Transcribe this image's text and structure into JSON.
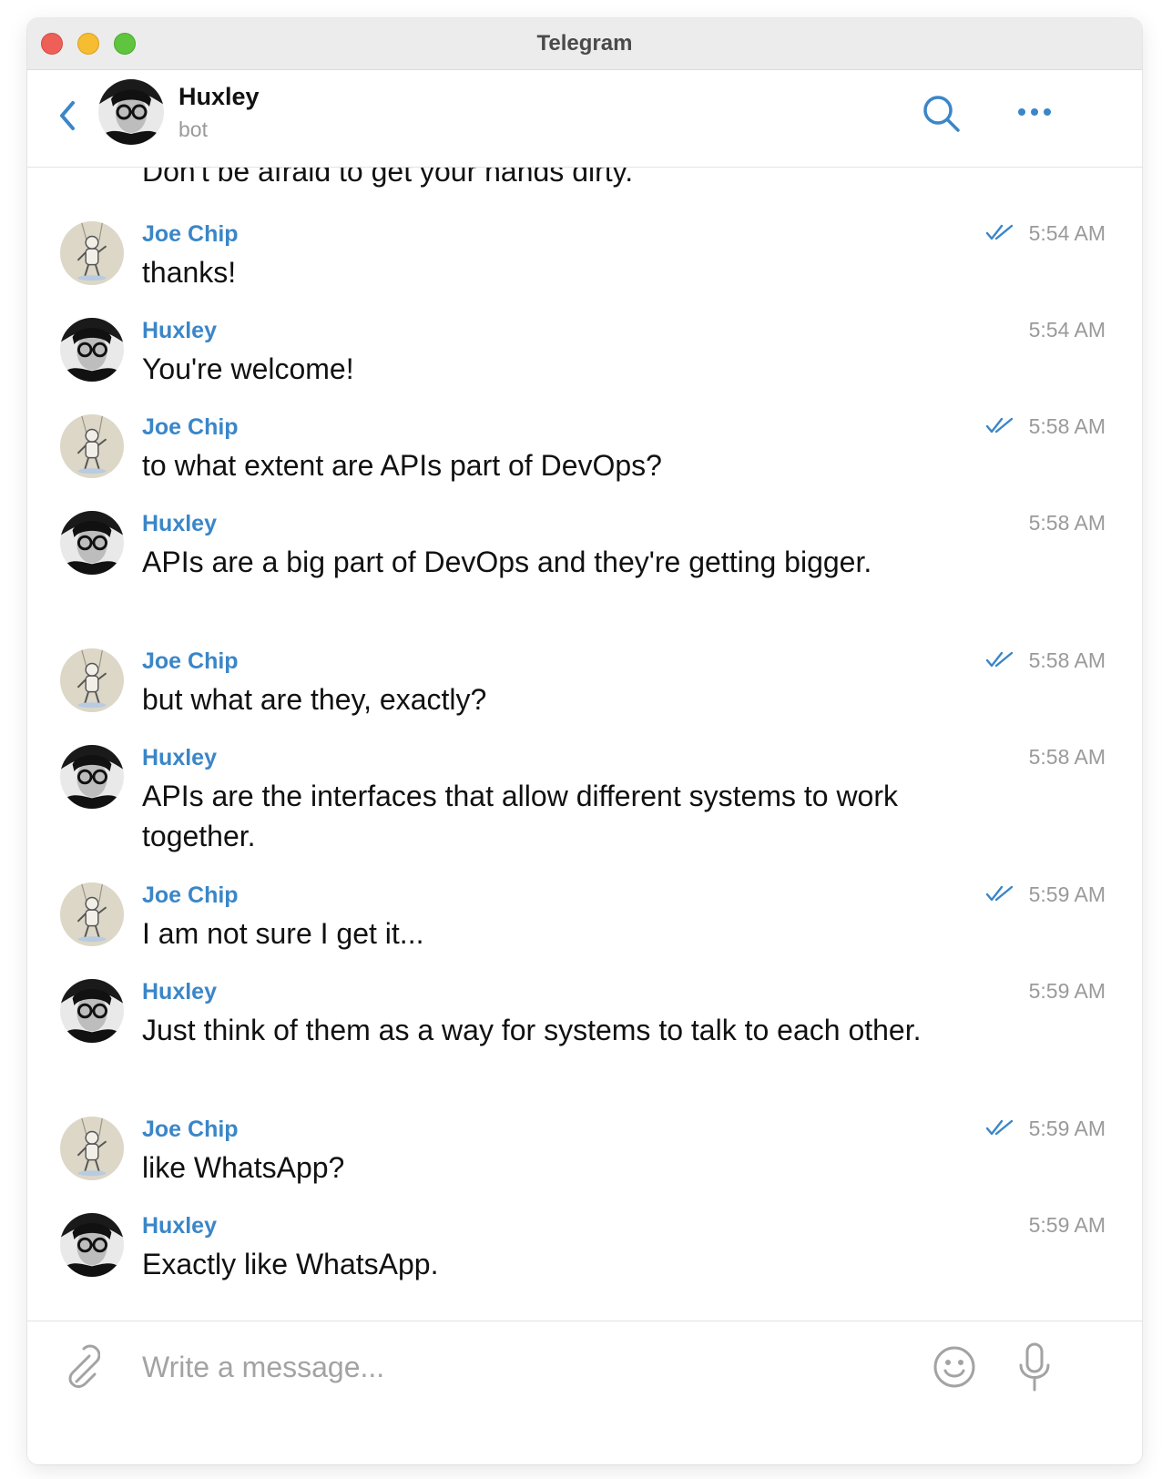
{
  "window": {
    "title": "Telegram"
  },
  "header": {
    "name": "Huxley",
    "status": "bot"
  },
  "chat": {
    "clipped_previous_text": "Don't be afraid to get your hands dirty.",
    "messages": [
      {
        "sender": "Joe Chip",
        "avatar": "joe",
        "text": "thanks!",
        "time": "5:54 AM",
        "read": true
      },
      {
        "sender": "Huxley",
        "avatar": "huxley",
        "text": "You're welcome!",
        "time": "5:54 AM",
        "read": false
      },
      {
        "sender": "Joe Chip",
        "avatar": "joe",
        "text": "to what extent are APIs part of DevOps?",
        "time": "5:58 AM",
        "read": true
      },
      {
        "sender": "Huxley",
        "avatar": "huxley",
        "text": "APIs are a big part of DevOps and they're getting bigger.",
        "time": "5:58 AM",
        "read": false
      },
      {
        "sender": "Joe Chip",
        "avatar": "joe",
        "text": "but what are they, exactly?",
        "time": "5:58 AM",
        "read": true
      },
      {
        "sender": "Huxley",
        "avatar": "huxley",
        "text": "APIs are the interfaces that allow different systems to work together.",
        "time": "5:58 AM",
        "read": false
      },
      {
        "sender": "Joe Chip",
        "avatar": "joe",
        "text": "I am not sure I get it...",
        "time": "5:59 AM",
        "read": true
      },
      {
        "sender": "Huxley",
        "avatar": "huxley",
        "text": "Just think of them as a way for systems to talk to each other.",
        "time": "5:59 AM",
        "read": false
      },
      {
        "sender": "Joe Chip",
        "avatar": "joe",
        "text": "like WhatsApp?",
        "time": "5:59 AM",
        "read": true
      },
      {
        "sender": "Huxley",
        "avatar": "huxley",
        "text": "Exactly like WhatsApp.",
        "time": "5:59 AM",
        "read": false
      }
    ]
  },
  "composer": {
    "placeholder": "Write a message..."
  },
  "colors": {
    "accent": "#3a86c8",
    "timestamp": "#9a9a9a",
    "titlebar": "#ececec"
  },
  "icons": {
    "back": "chevron-left-icon",
    "search": "search-icon",
    "more": "more-icon",
    "attach": "paperclip-icon",
    "emoji": "emoji-icon",
    "mic": "microphone-icon",
    "read": "double-check-icon"
  }
}
